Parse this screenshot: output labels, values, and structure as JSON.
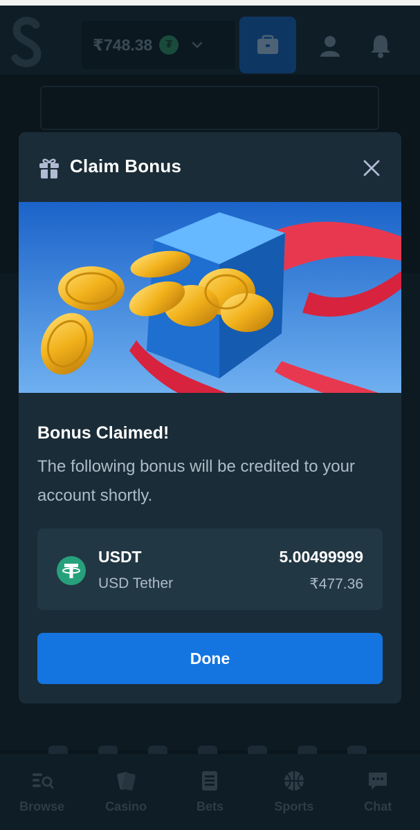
{
  "topbar": {
    "balance": "₹748.38",
    "balance_token_icon": "tether-icon",
    "balance_dropdown_icon": "chevron-down-icon",
    "wallet_icon": "wallet-icon",
    "profile_icon": "user-icon",
    "notifications_icon": "bell-icon"
  },
  "modal": {
    "title": "Claim Bonus",
    "title_icon": "gift-icon",
    "close_icon": "close-icon",
    "banner_image": "gift-box-with-coins",
    "claimed_title": "Bonus Claimed!",
    "claimed_description": "The following bonus will be credited to your account shortly.",
    "bonus": {
      "currency_code": "USDT",
      "currency_name": "USD Tether",
      "amount": "5.00499999",
      "fiat_value": "₹477.36",
      "icon": "tether-icon"
    },
    "done_label": "Done"
  },
  "bottom_nav": {
    "items": [
      {
        "label": "Browse",
        "icon": "browse-icon"
      },
      {
        "label": "Casino",
        "icon": "cards-icon"
      },
      {
        "label": "Bets",
        "icon": "bets-icon"
      },
      {
        "label": "Sports",
        "icon": "basketball-icon"
      },
      {
        "label": "Chat",
        "icon": "chat-icon"
      }
    ]
  },
  "colors": {
    "page_background": "#0b151c",
    "modal_background": "#1a2c37",
    "card_background": "#213743",
    "primary_button": "#1475e1",
    "tether_green": "#26a17b",
    "muted_text": "#aebcc7"
  }
}
